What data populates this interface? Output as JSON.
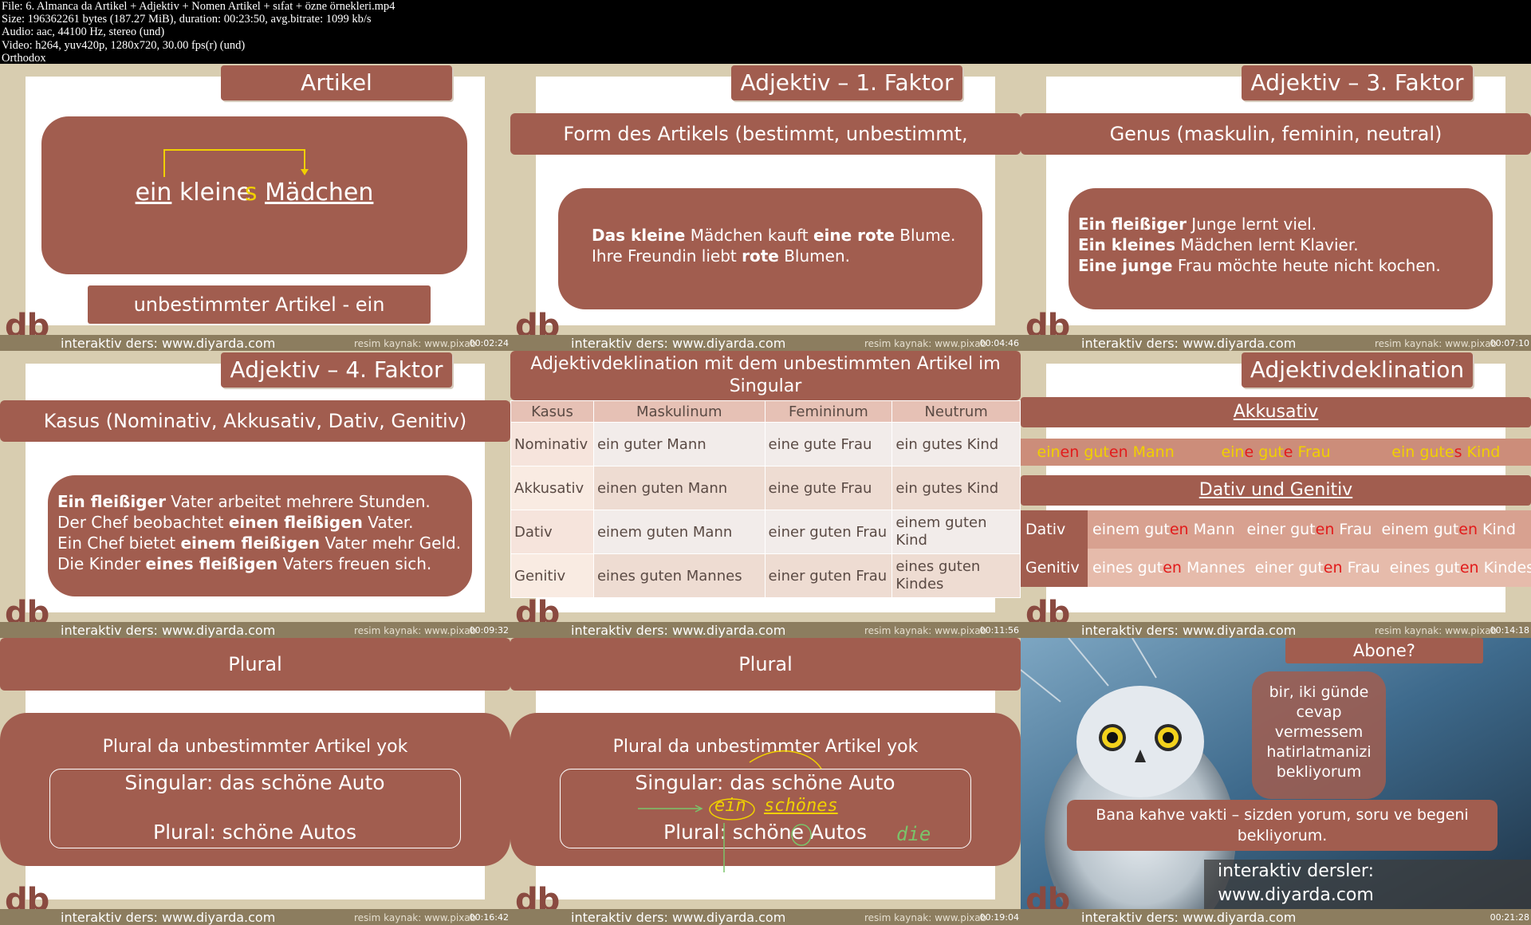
{
  "header": {
    "line1": "File: 6. Almanca da Artikel + Adjektiv + Nomen  Artikel + sıfat + özne örnekleri.mp4",
    "line2": "Size: 196362261 bytes (187.27 MiB), duration: 00:23:50, avg.bitrate: 1099 kb/s",
    "line3": "Audio: aac, 44100 Hz, stereo (und)",
    "line4": "Video: h264, yuv420p, 1280x720, 30.00 fps(r) (und)",
    "line5": "Orthodox"
  },
  "common": {
    "logo": "db",
    "site": "interaktiv ders: www.diyarda.com",
    "source": "resim kaynak: www.pixab"
  },
  "timestamps": [
    "00:02:24",
    "00:04:46",
    "00:07:10",
    "00:09:32",
    "00:11:56",
    "00:14:18",
    "00:16:42",
    "00:19:04",
    "00:21:28"
  ],
  "t1": {
    "title": "Artikel",
    "w1": "ein",
    "w2": "kleine",
    "w2s": "s",
    "w3": "Mädchen",
    "caption": "unbestimmter Artikel - ein"
  },
  "t2": {
    "title": "Adjektiv – 1. Faktor",
    "strip": "Form des Artikels (bestimmt, unbestimmt, Nullartikel)",
    "a": "Das kleine",
    "b": " Mädchen kauft ",
    "c": "eine rote",
    "d": " Blume.",
    "e": "Ihre Freundin liebt ",
    "f": "rote",
    "g": " Blumen."
  },
  "t3": {
    "title": "Adjektiv – 3. Faktor",
    "strip": "Genus (maskulin, feminin, neutral)",
    "l1b": "Ein fleißiger",
    "l1": " Junge lernt viel.",
    "l2b": "Ein kleines",
    "l2": " Mädchen lernt Klavier.",
    "l3b": "Eine junge",
    "l3": " Frau möchte heute nicht kochen."
  },
  "t4": {
    "title": "Adjektiv – 4. Faktor",
    "strip": "Kasus (Nominativ, Akkusativ, Dativ, Genitiv)",
    "l1b": "Ein fleißiger",
    "l1": " Vater arbeitet mehrere Stunden.",
    "l2a": "Der Chef beobachtet ",
    "l2b": "einen fleißigen",
    "l2c": " Vater.",
    "l3a": "Ein Chef bietet ",
    "l3b": "einem fleißigen",
    "l3c": " Vater mehr Geld.",
    "l4a": "Die Kinder ",
    "l4b": "eines fleißigen",
    "l4c": " Vaters freuen sich."
  },
  "t5": {
    "title": "Adjektivdeklination mit dem unbestimmten Artikel im Singular",
    "headers": [
      "Kasus",
      "Maskulinum",
      "Femininum",
      "Neutrum"
    ],
    "rows": [
      [
        "Nominativ",
        "ein guter Mann",
        "eine gute Frau",
        "ein gutes Kind"
      ],
      [
        "Akkusativ",
        "einen guten Mann",
        "eine gute Frau",
        "ein gutes Kind"
      ],
      [
        "Dativ",
        "einem guten Mann",
        "einer guten Frau",
        "einem guten Kind"
      ],
      [
        "Genitiv",
        "eines guten Mannes",
        "einer guten Frau",
        "eines guten Kindes"
      ]
    ]
  },
  "t6": {
    "title": "Adjektivdeklination",
    "akk": "Akkusativ",
    "dg": "Dativ und Genitiv",
    "akk_row": [
      [
        "ein",
        "en",
        " gut",
        "en",
        " Mann"
      ],
      [
        "ein",
        "e",
        " gut",
        "e",
        " Frau"
      ],
      [
        "ein",
        " gute",
        "s",
        " Kind"
      ]
    ],
    "dat_label": "Dativ",
    "gen_label": "Genitiv",
    "dat": [
      [
        "einem gut",
        "en",
        " Mann"
      ],
      [
        "einer gut",
        "en",
        " Frau"
      ],
      [
        "einem gut",
        "en",
        " Kind"
      ]
    ],
    "gen": [
      [
        "eines gut",
        "en",
        " Mannes"
      ],
      [
        "einer gut",
        "en",
        " Frau"
      ],
      [
        "eines gut",
        "en",
        " Kindes"
      ]
    ]
  },
  "t7": {
    "title": "Plural",
    "l1": "Plural da unbestimmter Artikel yok",
    "l2": "Singular: das schöne Auto",
    "l3": "Plural: schöne Autos"
  },
  "t8": {
    "title": "Plural",
    "l1": "Plural da unbestimmter Artikel yok",
    "l2": "Singular: das schöne Auto",
    "l3": "Plural: schöne Autos",
    "hw1": "ein",
    "hw2": "schönes",
    "hw3": "die"
  },
  "t9": {
    "title": "Abone?",
    "bubble": "bir, iki günde cevap vermessem hatirlatmanizi bekliyorum",
    "box": "Bana kahve vakti – sizden yorum, soru ve begeni bekliyorum.",
    "site1": "interaktiv dersler:",
    "site2": "www.diyarda.com"
  },
  "colors": {
    "brand": "#a15d4f",
    "yellow": "#f0d000",
    "red": "#e21b1b",
    "footer": "#8c7d5f"
  }
}
